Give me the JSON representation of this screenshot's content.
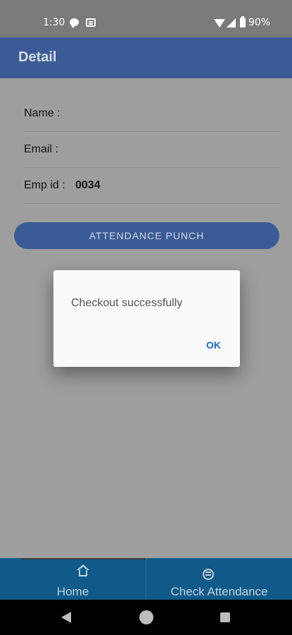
{
  "status_bar": {
    "time": "1:30",
    "battery": "90%"
  },
  "app_bar": {
    "title": "Detail"
  },
  "fields": [
    {
      "label": "Name :",
      "value": ""
    },
    {
      "label": "Email :",
      "value": ""
    },
    {
      "label": "Emp id :",
      "value": "0034"
    }
  ],
  "punch_button": {
    "label": "ATTENDANCE PUNCH"
  },
  "dialog": {
    "message": "Checkout successfully",
    "ok_label": "OK"
  },
  "bottom_nav": {
    "tabs": [
      {
        "label": "Home",
        "icon": "home-icon"
      },
      {
        "label": "Check Attendance",
        "icon": "wifi-circle-icon"
      }
    ]
  },
  "colors": {
    "accent": "#3a5b96",
    "nav": "#0f5a88",
    "dialog_button": "#1a6fc9"
  }
}
